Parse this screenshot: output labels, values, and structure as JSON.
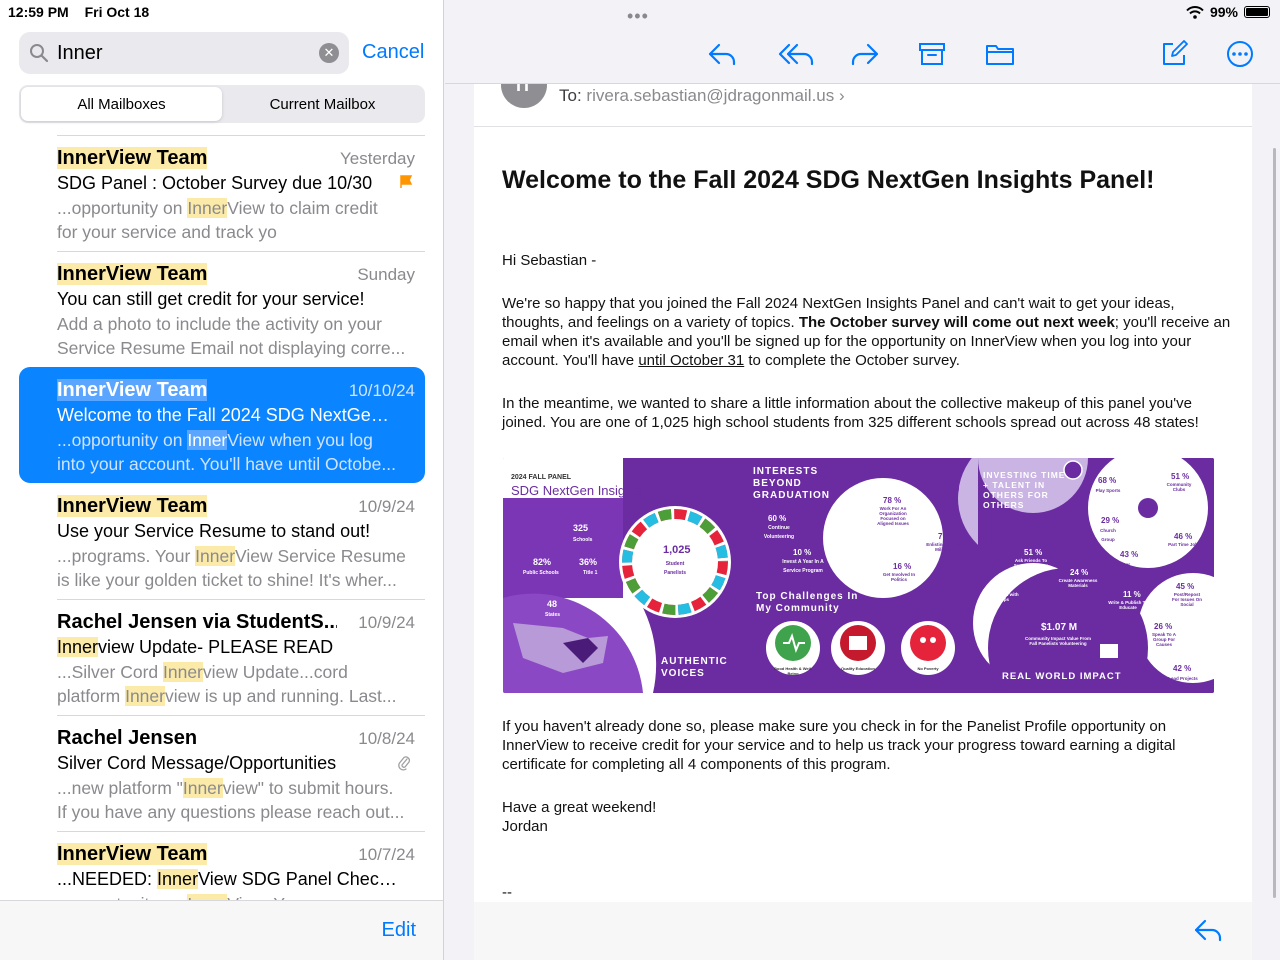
{
  "status": {
    "time": "12:59 PM",
    "date": "Fri Oct 18",
    "battery": "99%"
  },
  "search": {
    "query": "Inner",
    "cancel_label": "Cancel"
  },
  "scope": {
    "all": "All Mailboxes",
    "current": "Current Mailbox"
  },
  "messages": [
    {
      "sender": "InnerView Team",
      "date": "Yesterday",
      "subject": "SDG Panel : October Survey due 10/30",
      "p1": "...opportunity on ",
      "p1h": "Inner",
      "p1b": "View to claim credit",
      "p2": "for your service and track yo",
      "flagged": true
    },
    {
      "sender": "InnerView Team",
      "date": "Sunday",
      "subject": "You can still get credit for your service!",
      "p1": "Add a photo to include the activity on your",
      "p2": "Service Resume Email not displaying corre..."
    },
    {
      "sender": "InnerView Team",
      "date": "10/10/24",
      "subject": "Welcome to the Fall 2024 SDG NextGen In...",
      "p1": "...opportunity on ",
      "p1h": "Inner",
      "p1b": "View when you log",
      "p2": "into your account. You'll have until Octobe..."
    },
    {
      "sender": "InnerView Team",
      "date": "10/9/24",
      "subject": "Use your Service Resume to stand out!",
      "p1": "...programs. Your ",
      "p1h": "Inner",
      "p1b": "View Service Resume",
      "p2": "is like your golden ticket to shine! It's wher..."
    },
    {
      "sender": "Rachel Jensen via StudentS...",
      "date": "10/9/24",
      "subject_h": "Inner",
      "subject": "view Update- PLEASE READ",
      "p1": "...Silver Cord ",
      "p1h": "Inner",
      "p1b": "view Update...cord",
      "p2": "platform ",
      "p2h": "Inner",
      "p2b": "view is up and running. Last..."
    },
    {
      "sender": "Rachel Jensen",
      "date": "10/8/24",
      "subject": "Silver Cord Message/Opportunities",
      "p1": "...new platform \"",
      "p1h": "Inner",
      "p1b": "view\" to submit hours.",
      "p2": "If you have any questions please reach out...",
      "attachment": true
    },
    {
      "sender": "InnerView Team",
      "date": "10/7/24",
      "subject_pre": "...NEEDED: ",
      "subject_h": "Inner",
      "subject": "View SDG Panel Check-in",
      "p1": "...opportunity on ",
      "p1h": "Inner",
      "p1b": "View. You can use a",
      "p2": ""
    }
  ],
  "left_footer": {
    "edit_label": "Edit"
  },
  "email": {
    "avatar_initials": "IT",
    "to_label": "To:",
    "to_address": "rivera.sebastian@jdragonmail.us",
    "to_chevron": "›",
    "title": "Welcome to the Fall 2024 SDG NextGen Insights Panel!",
    "greeting": "Hi Sebastian -",
    "para1_a": "We're so happy that you joined the Fall 2024 NextGen Insights Panel and can't wait to get your ideas, thoughts, and feelings on a variety of topics. ",
    "para1_b": "The October survey will come out next week",
    "para1_c": "; you'll receive an email when it's available and you'll be signed up for the opportunity on InnerView when you log into your account. You'll have ",
    "para1_d": "until October 31",
    "para1_e": " to complete the October survey.",
    "para2": "In the meantime, we wanted to share a little information about the collective makeup of this panel you've joined. You are one of 1,025 high school students from 325 different schools spread out across 48 states!",
    "para3": "If you haven't already done so, please make sure you check in for the Panelist Profile opportunity on InnerView to receive credit for your service and to help us track your progress toward earning a digital certificate for completing all 4 components of this program.",
    "closing": "Have a great weekend!",
    "signature": "Jordan",
    "sig_sep": "--"
  },
  "infographic": {
    "panel_label": "2024 FALL PANEL",
    "panel_title": "SDG NextGen Insights",
    "schools": "325",
    "schools_label": "Schools",
    "public": "82%",
    "public_label": "Public Schools",
    "title1": "36%",
    "title1_label": "Title 1",
    "states": "48",
    "states_label": "States",
    "students": "1,025",
    "students_label": "Student Panelists",
    "authentic": "AUTHENTIC VOICES",
    "interests": "INTERESTS BEYOND GRADUATION",
    "i60": "60 %",
    "i60_label": "Continue Volunteering",
    "i10": "10 %",
    "i10_label": "Invest A Year In A Service Program",
    "i78": "78 %",
    "i78_label": "Work For An Organization Focused on Aligned Issues",
    "i7": "7 %",
    "i7_label": "Enlisting In The Military",
    "i16": "16 %",
    "i16_label": "Get Involved In Politics",
    "challenges": "Top Challenges In My Community",
    "c1": "Good Health & Well-Being",
    "c2": "Quality Education",
    "c3": "No Poverty",
    "investing": "INVESTING TIME + TALENT IN OTHERS FOR OTHERS",
    "r68": "68 %",
    "r68_label": "Play Sports",
    "r51a": "51 %",
    "r51a_label": "Community Clubs",
    "r29": "29 %",
    "r29_label": "Church Group",
    "r46": "46 %",
    "r46_label": "Part Time Job",
    "r43": "43 %",
    "r43_label": "Tutor",
    "r51b": "51 %",
    "r51b_label": "Ask Friends To Support Causes",
    "r24": "24 %",
    "r24_label": "Create Awareness Materials",
    "r65": "65 %",
    "r65_label": "Take Action with Groups",
    "r11": "11 %",
    "r11_label": "Write & Publish To Educate",
    "r45": "45 %",
    "r45_label": "Post/Repost For Issues On Social",
    "impact": "$1.07 M",
    "impact_label": "Community Impact Value From Fall Panelists Volunteering",
    "r26": "26 %",
    "r26_label": "Speak To A Group For Causes",
    "r42": "42 %",
    "r42_label": "Lead Projects",
    "real": "REAL WORLD IMPACT"
  }
}
